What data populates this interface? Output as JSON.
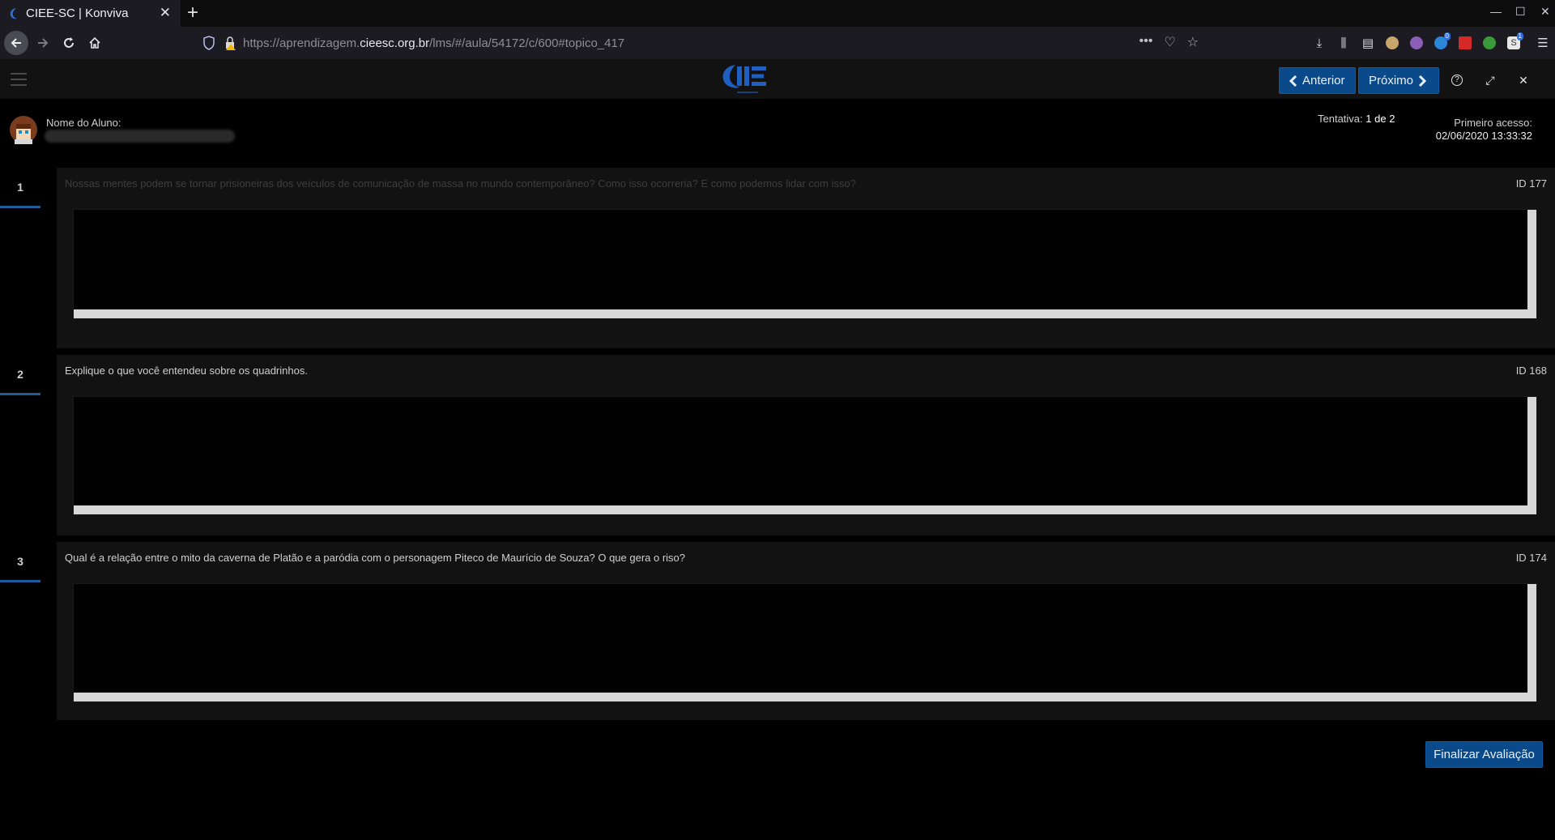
{
  "browser": {
    "tab_title": "CIEE-SC | Konviva",
    "tab_close": "✕",
    "new_tab": "+",
    "url_prefix": "https://aprendizagem.",
    "url_host": "cieesc.org.br",
    "url_path": "/lms/#/aula/54172/c/600#topico_417",
    "ext_badge_1": "0",
    "ext_badge_2": "1",
    "ext_label": "S"
  },
  "header": {
    "prev_label": "Anterior",
    "next_label": "Próximo",
    "help_icon": "?",
    "expand_icon": "⤢",
    "close_icon": "✕"
  },
  "student": {
    "label": "Nome do Aluno:",
    "attempt_label": "Tentativa:",
    "attempt_value": "1 de 2",
    "first_access_label": "Primeiro acesso:",
    "first_access_date": "02/06/2020 13:33:32"
  },
  "questions": [
    {
      "number": "1",
      "text": "Nossas mentes podem se tornar prisioneiras dos veículos de comunicação de massa no mundo contemporâneo? Como isso ocorreria? E como podemos lidar com isso?",
      "id_label": "ID 177"
    },
    {
      "number": "2",
      "text": "Explique o que você entendeu sobre os quadrinhos.",
      "id_label": "ID 168"
    },
    {
      "number": "3",
      "text": "Qual é a relação entre o mito da caverna de Platão e a paródia com o personagem Piteco de Maurício de Souza? O que gera o riso?",
      "id_label": "ID 174"
    }
  ],
  "finalize_label": "Finalizar Avaliação",
  "colors": {
    "accent": "#0a4a8a",
    "background": "#000000",
    "card": "#121212"
  }
}
